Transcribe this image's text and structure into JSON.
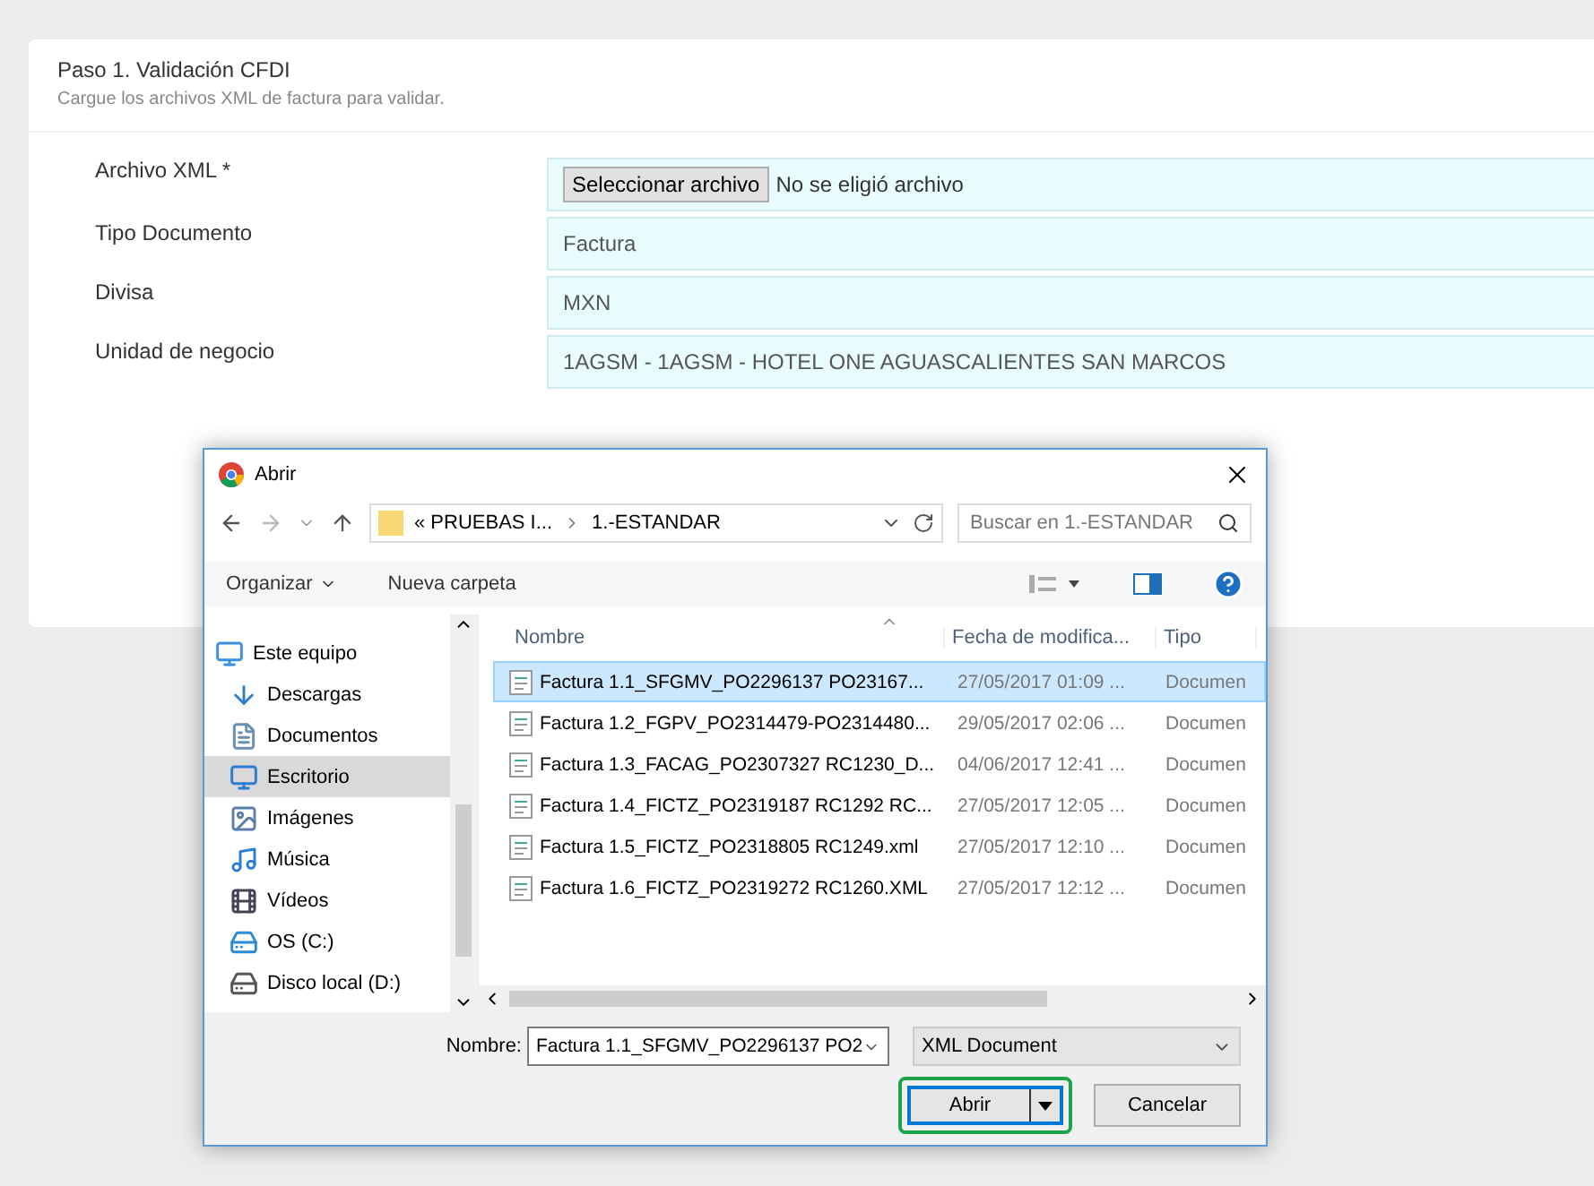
{
  "step": {
    "title": "Paso 1. Validación CFDI",
    "subtitle": "Cargue los archivos XML de factura para validar."
  },
  "form": {
    "rows": [
      {
        "label": "Archivo XML *",
        "kind": "file",
        "button": "Seleccionar archivo",
        "value": "No se eligió archivo"
      },
      {
        "label": "Tipo Documento",
        "kind": "text",
        "value": "Factura"
      },
      {
        "label": "Divisa",
        "kind": "text",
        "value": "MXN"
      },
      {
        "label": "Unidad de negocio",
        "kind": "text",
        "value": "1AGSM - 1AGSM - HOTEL ONE AGUASCALIENTES SAN MARCOS"
      }
    ]
  },
  "dialog": {
    "title": "Abrir",
    "path": [
      "« PRUEBAS I...",
      "1.-ESTANDAR"
    ],
    "search_placeholder": "Buscar en 1.-ESTANDAR",
    "toolbar": {
      "organize": "Organizar",
      "new_folder": "Nueva carpeta"
    },
    "sidebar": {
      "items": [
        {
          "label": "Este equipo",
          "kind": "computer",
          "selected": false
        },
        {
          "label": "Descargas",
          "kind": "download",
          "selected": false
        },
        {
          "label": "Documentos",
          "kind": "document",
          "selected": false
        },
        {
          "label": "Escritorio",
          "kind": "desktop",
          "selected": true
        },
        {
          "label": "Imágenes",
          "kind": "images",
          "selected": false
        },
        {
          "label": "Música",
          "kind": "music",
          "selected": false
        },
        {
          "label": "Vídeos",
          "kind": "video",
          "selected": false
        },
        {
          "label": "OS (C:)",
          "kind": "system-drive",
          "selected": false
        },
        {
          "label": "Disco local (D:)",
          "kind": "drive",
          "selected": false
        }
      ]
    },
    "columns": [
      "Nombre",
      "Fecha de modifica...",
      "Tipo"
    ],
    "files": [
      {
        "name": "Factura 1.1_SFGMV_PO2296137 PO23167...",
        "date": "27/05/2017 01:09 ...",
        "type": "Documen",
        "selected": true
      },
      {
        "name": "Factura 1.2_FGPV_PO2314479-PO2314480...",
        "date": "29/05/2017 02:06 ...",
        "type": "Documen",
        "selected": false
      },
      {
        "name": "Factura 1.3_FACAG_PO2307327 RC1230_D...",
        "date": "04/06/2017 12:41 ...",
        "type": "Documen",
        "selected": false
      },
      {
        "name": "Factura 1.4_FICTZ_PO2319187 RC1292 RC...",
        "date": "27/05/2017 12:05 ...",
        "type": "Documen",
        "selected": false
      },
      {
        "name": "Factura 1.5_FICTZ_PO2318805 RC1249.xml",
        "date": "27/05/2017 12:10 ...",
        "type": "Documen",
        "selected": false
      },
      {
        "name": "Factura 1.6_FICTZ_PO2319272 RC1260.XML",
        "date": "27/05/2017 12:12 ...",
        "type": "Documen",
        "selected": false
      }
    ],
    "filename_label": "Nombre:",
    "filename_value": "Factura 1.1_SFGMV_PO2296137 PO2",
    "filetype": "XML Document",
    "open_button": "Abrir",
    "cancel_button": "Cancelar"
  }
}
